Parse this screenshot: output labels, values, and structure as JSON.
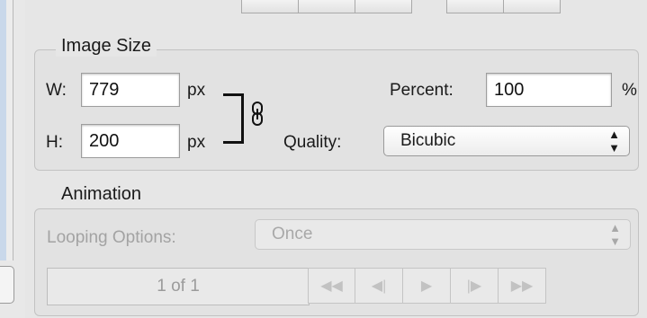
{
  "image_size": {
    "title": "Image Size",
    "width_label": "W:",
    "width_value": "779",
    "width_unit": "px",
    "height_label": "H:",
    "height_value": "200",
    "height_unit": "px",
    "percent_label": "Percent:",
    "percent_value": "100",
    "percent_unit": "%",
    "quality_label": "Quality:",
    "quality_value": "Bicubic"
  },
  "animation": {
    "title": "Animation",
    "looping_label": "Looping Options:",
    "looping_value": "Once",
    "frame_counter": "1 of 1",
    "nav_icons": [
      "first-frame-icon",
      "previous-frame-icon",
      "play-icon",
      "next-frame-icon",
      "last-frame-icon"
    ]
  },
  "icons": {
    "link": "chain-link-icon",
    "select_arrows": "up-down-arrows-icon"
  }
}
